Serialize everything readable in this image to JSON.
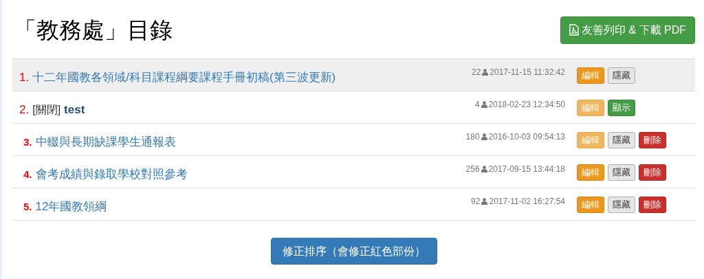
{
  "page_title": "「教務處」目錄",
  "print_button": {
    "label": "友善列印 & 下載 PDF"
  },
  "rows": [
    {
      "number": "1.",
      "bold_number": false,
      "prefix": "",
      "title": "十二年國教各領域/科目課程綱要課程手冊初稿(第三波更新)",
      "count": "22",
      "time": "2017-11-15 11:32:42",
      "highlighted": true,
      "buttons": [
        {
          "label": "編輯",
          "kind": "edit",
          "faded": false
        },
        {
          "label": "隱藏",
          "kind": "hide",
          "faded": false
        }
      ]
    },
    {
      "number": "2.",
      "bold_number": false,
      "prefix": "[關閉]",
      "title": "test",
      "count": "4",
      "time": "2018-02-23 12:34:50",
      "highlighted": false,
      "buttons": [
        {
          "label": "編輯",
          "kind": "edit",
          "faded": true
        },
        {
          "label": "顯示",
          "kind": "show",
          "faded": false
        }
      ]
    },
    {
      "number": "3.",
      "bold_number": true,
      "prefix": "",
      "title": "中輟與長期缺課學生通報表",
      "count": "180",
      "time": "2016-10-03 09:54:13",
      "highlighted": false,
      "buttons": [
        {
          "label": "編輯",
          "kind": "edit",
          "faded": true
        },
        {
          "label": "隱藏",
          "kind": "hide",
          "faded": false
        },
        {
          "label": "刪除",
          "kind": "delete",
          "faded": false
        }
      ]
    },
    {
      "number": "4.",
      "bold_number": true,
      "prefix": "",
      "title": "會考成績與錄取學校對照參考",
      "count": "256",
      "time": "2017-09-15 13:44:18",
      "highlighted": false,
      "buttons": [
        {
          "label": "編輯",
          "kind": "edit",
          "faded": false
        },
        {
          "label": "隱藏",
          "kind": "hide",
          "faded": false
        },
        {
          "label": "刪除",
          "kind": "delete",
          "faded": false
        }
      ]
    },
    {
      "number": "5.",
      "bold_number": true,
      "prefix": "",
      "title": "12年國教領綱",
      "count": "92",
      "time": "2017-11-02 16:27:54",
      "highlighted": false,
      "buttons": [
        {
          "label": "編輯",
          "kind": "edit",
          "faded": false
        },
        {
          "label": "隱藏",
          "kind": "hide",
          "faded": false
        },
        {
          "label": "刪除",
          "kind": "delete",
          "faded": false
        }
      ]
    }
  ],
  "sort_button": {
    "label": "修正排序（會修正紅色部份）"
  }
}
